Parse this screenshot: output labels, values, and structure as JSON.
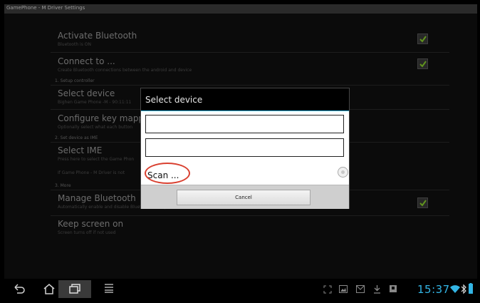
{
  "title_bar": {
    "title": "GamePhone - M Driver Settings"
  },
  "settings": {
    "activate_bluetooth": {
      "title": "Activate Bluetooth",
      "summary": "Bluetooth is ON",
      "checked": true
    },
    "connect_to": {
      "title": "Connect to ...",
      "summary": "Create Bluetooth connections between the android and device",
      "checked": true
    },
    "section_setup": "1. Setup controller",
    "select_device": {
      "title": "Select device",
      "summary": "Bighen Game Phone -M - 90:11:11"
    },
    "configure_key_mapping": {
      "title": "Configure key mappin",
      "summary": "Optionally select what each button"
    },
    "section_ime": "2. Set device as IME",
    "select_ime": {
      "title": "Select IME",
      "summary": "Press here to select the Game Phon"
    },
    "ime_note": "If Game Phone - M Driver is not",
    "section_more": "3. More",
    "manage_bluetooth": {
      "title": "Manage Bluetooth",
      "summary": "Automatically enable and disable Bluetooth as required",
      "checked": true
    },
    "keep_screen_on": {
      "title": "Keep screen on",
      "summary": "Screen turns off if not used"
    }
  },
  "dialog": {
    "title": "Select device",
    "field1_value": "",
    "field2_value": "",
    "scan_label": "Scan ...",
    "cancel_label": "Cancel"
  },
  "status_bar": {
    "time": "15:37"
  },
  "colors": {
    "accent": "#33b5e5",
    "highlight_circle": "#d94030",
    "check": "#8bd52b"
  }
}
